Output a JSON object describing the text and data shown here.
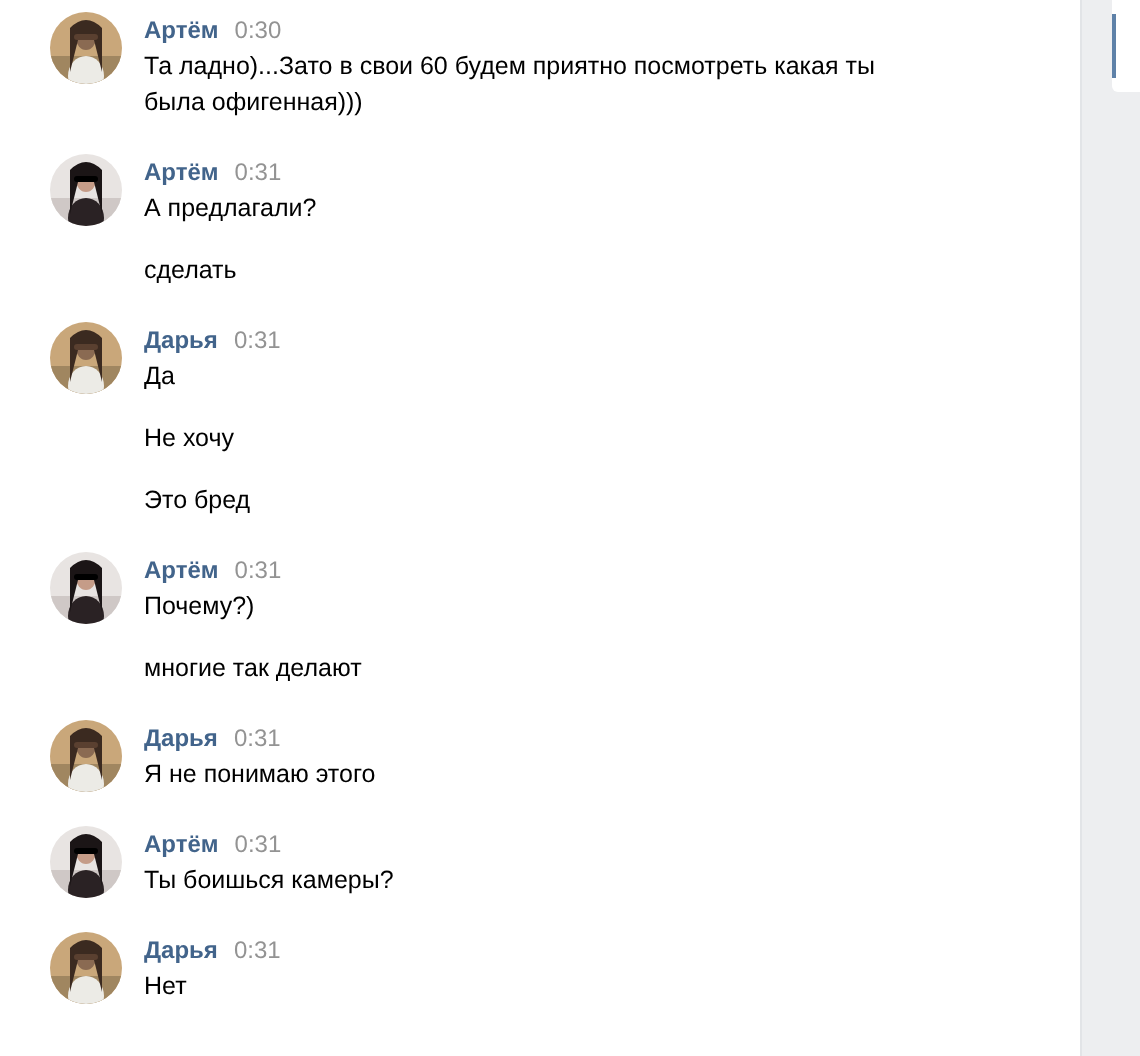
{
  "messages": [
    {
      "author": "Артём",
      "time": "0:30",
      "texts": [
        "Та ладно)...Зато в свои 60 будем приятно посмотреть какая ты была офигенная)))"
      ]
    },
    {
      "author": "Артём",
      "time": "0:31",
      "texts": [
        "А предлагали?",
        "сделать"
      ]
    },
    {
      "author": "Дарья",
      "time": "0:31",
      "texts": [
        "Да",
        "Не хочу",
        "Это бред"
      ]
    },
    {
      "author": "Артём",
      "time": "0:31",
      "texts": [
        "Почему?)",
        "многие так делают"
      ]
    },
    {
      "author": "Дарья",
      "time": "0:31",
      "texts": [
        "Я не понимаю этого"
      ]
    },
    {
      "author": "Артём",
      "time": "0:31",
      "texts": [
        "Ты боишься камеры?"
      ]
    },
    {
      "author": "Дарья",
      "time": "0:31",
      "texts": [
        "Нет"
      ]
    }
  ]
}
